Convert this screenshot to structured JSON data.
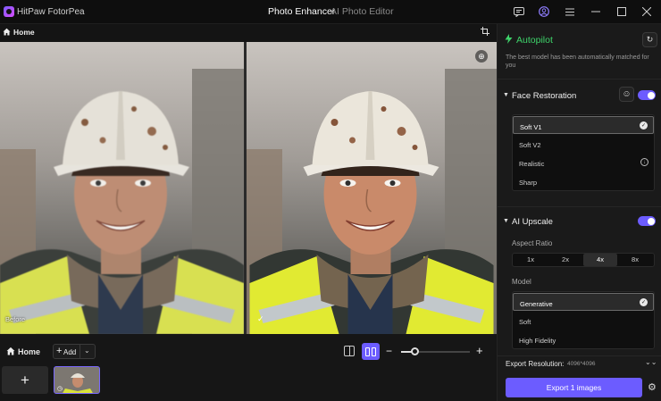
{
  "app": {
    "title": "HitPaw FotorPea",
    "tabs": [
      "Photo Enhancer",
      "AI Photo Editor"
    ]
  },
  "window_controls": {
    "icons": [
      "feedback-icon",
      "account-icon",
      "menu-icon",
      "minimize-icon",
      "maximize-icon",
      "close-icon"
    ]
  },
  "toolbar": {
    "home_label": "Home"
  },
  "viewer": {
    "before_label": "Before",
    "after_label": "✓"
  },
  "bottom": {
    "home_label": "Home",
    "add_label": "Add",
    "zoom_level": 0.2
  },
  "panel": {
    "autopilot": {
      "title": "Autopilot",
      "description": "The best model has been automatically matched for you"
    },
    "face_restoration": {
      "title": "Face Restoration",
      "enabled": true,
      "options": [
        "Soft V1",
        "Soft V2",
        "Realistic",
        "Sharp"
      ],
      "selected": "Soft V1"
    },
    "ai_upscale": {
      "title": "AI Upscale",
      "enabled": true,
      "aspect_ratio_label": "Aspect Ratio",
      "ratios": [
        "1x",
        "2x",
        "4x",
        "8x"
      ],
      "selected_ratio": "4x",
      "model_label": "Model",
      "models": [
        "Generative",
        "Soft",
        "High Fidelity"
      ],
      "selected_model": "Generative"
    },
    "export": {
      "resolution_label": "Export Resolution:",
      "resolution_value": "4096*4096",
      "button_label": "Export 1 images"
    }
  },
  "colors": {
    "accent": "#6c5cff",
    "autopilot_green": "#3ed36a",
    "background": "#141414",
    "panel": "#1a1a1a"
  }
}
